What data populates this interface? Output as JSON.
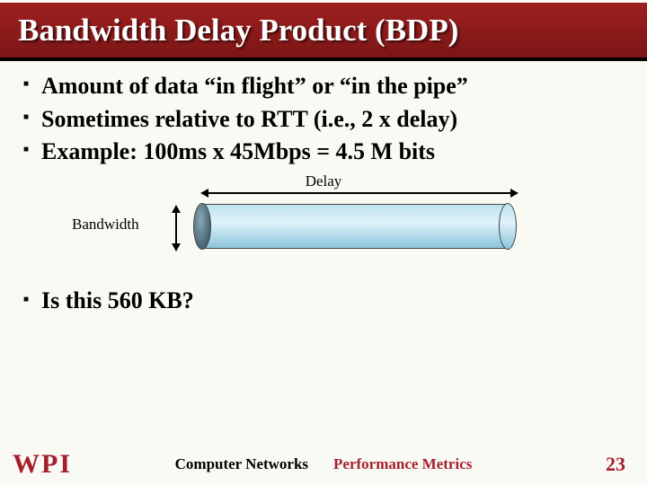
{
  "title": "Bandwidth Delay Product (BDP)",
  "bullets": [
    "Amount of data “in flight” or “in the pipe”",
    "Sometimes relative to RTT (i.e., 2 x delay)",
    "Example: 100ms x 45Mbps = 4.5 M bits"
  ],
  "diagram": {
    "delay_label": "Delay",
    "bandwidth_label": "Bandwidth"
  },
  "question": "Is this 560 KB?",
  "footer": {
    "logo_letters": [
      "W",
      "P",
      "I"
    ],
    "center_left": "Computer Networks",
    "center_right": "Performance Metrics",
    "page": "23"
  }
}
